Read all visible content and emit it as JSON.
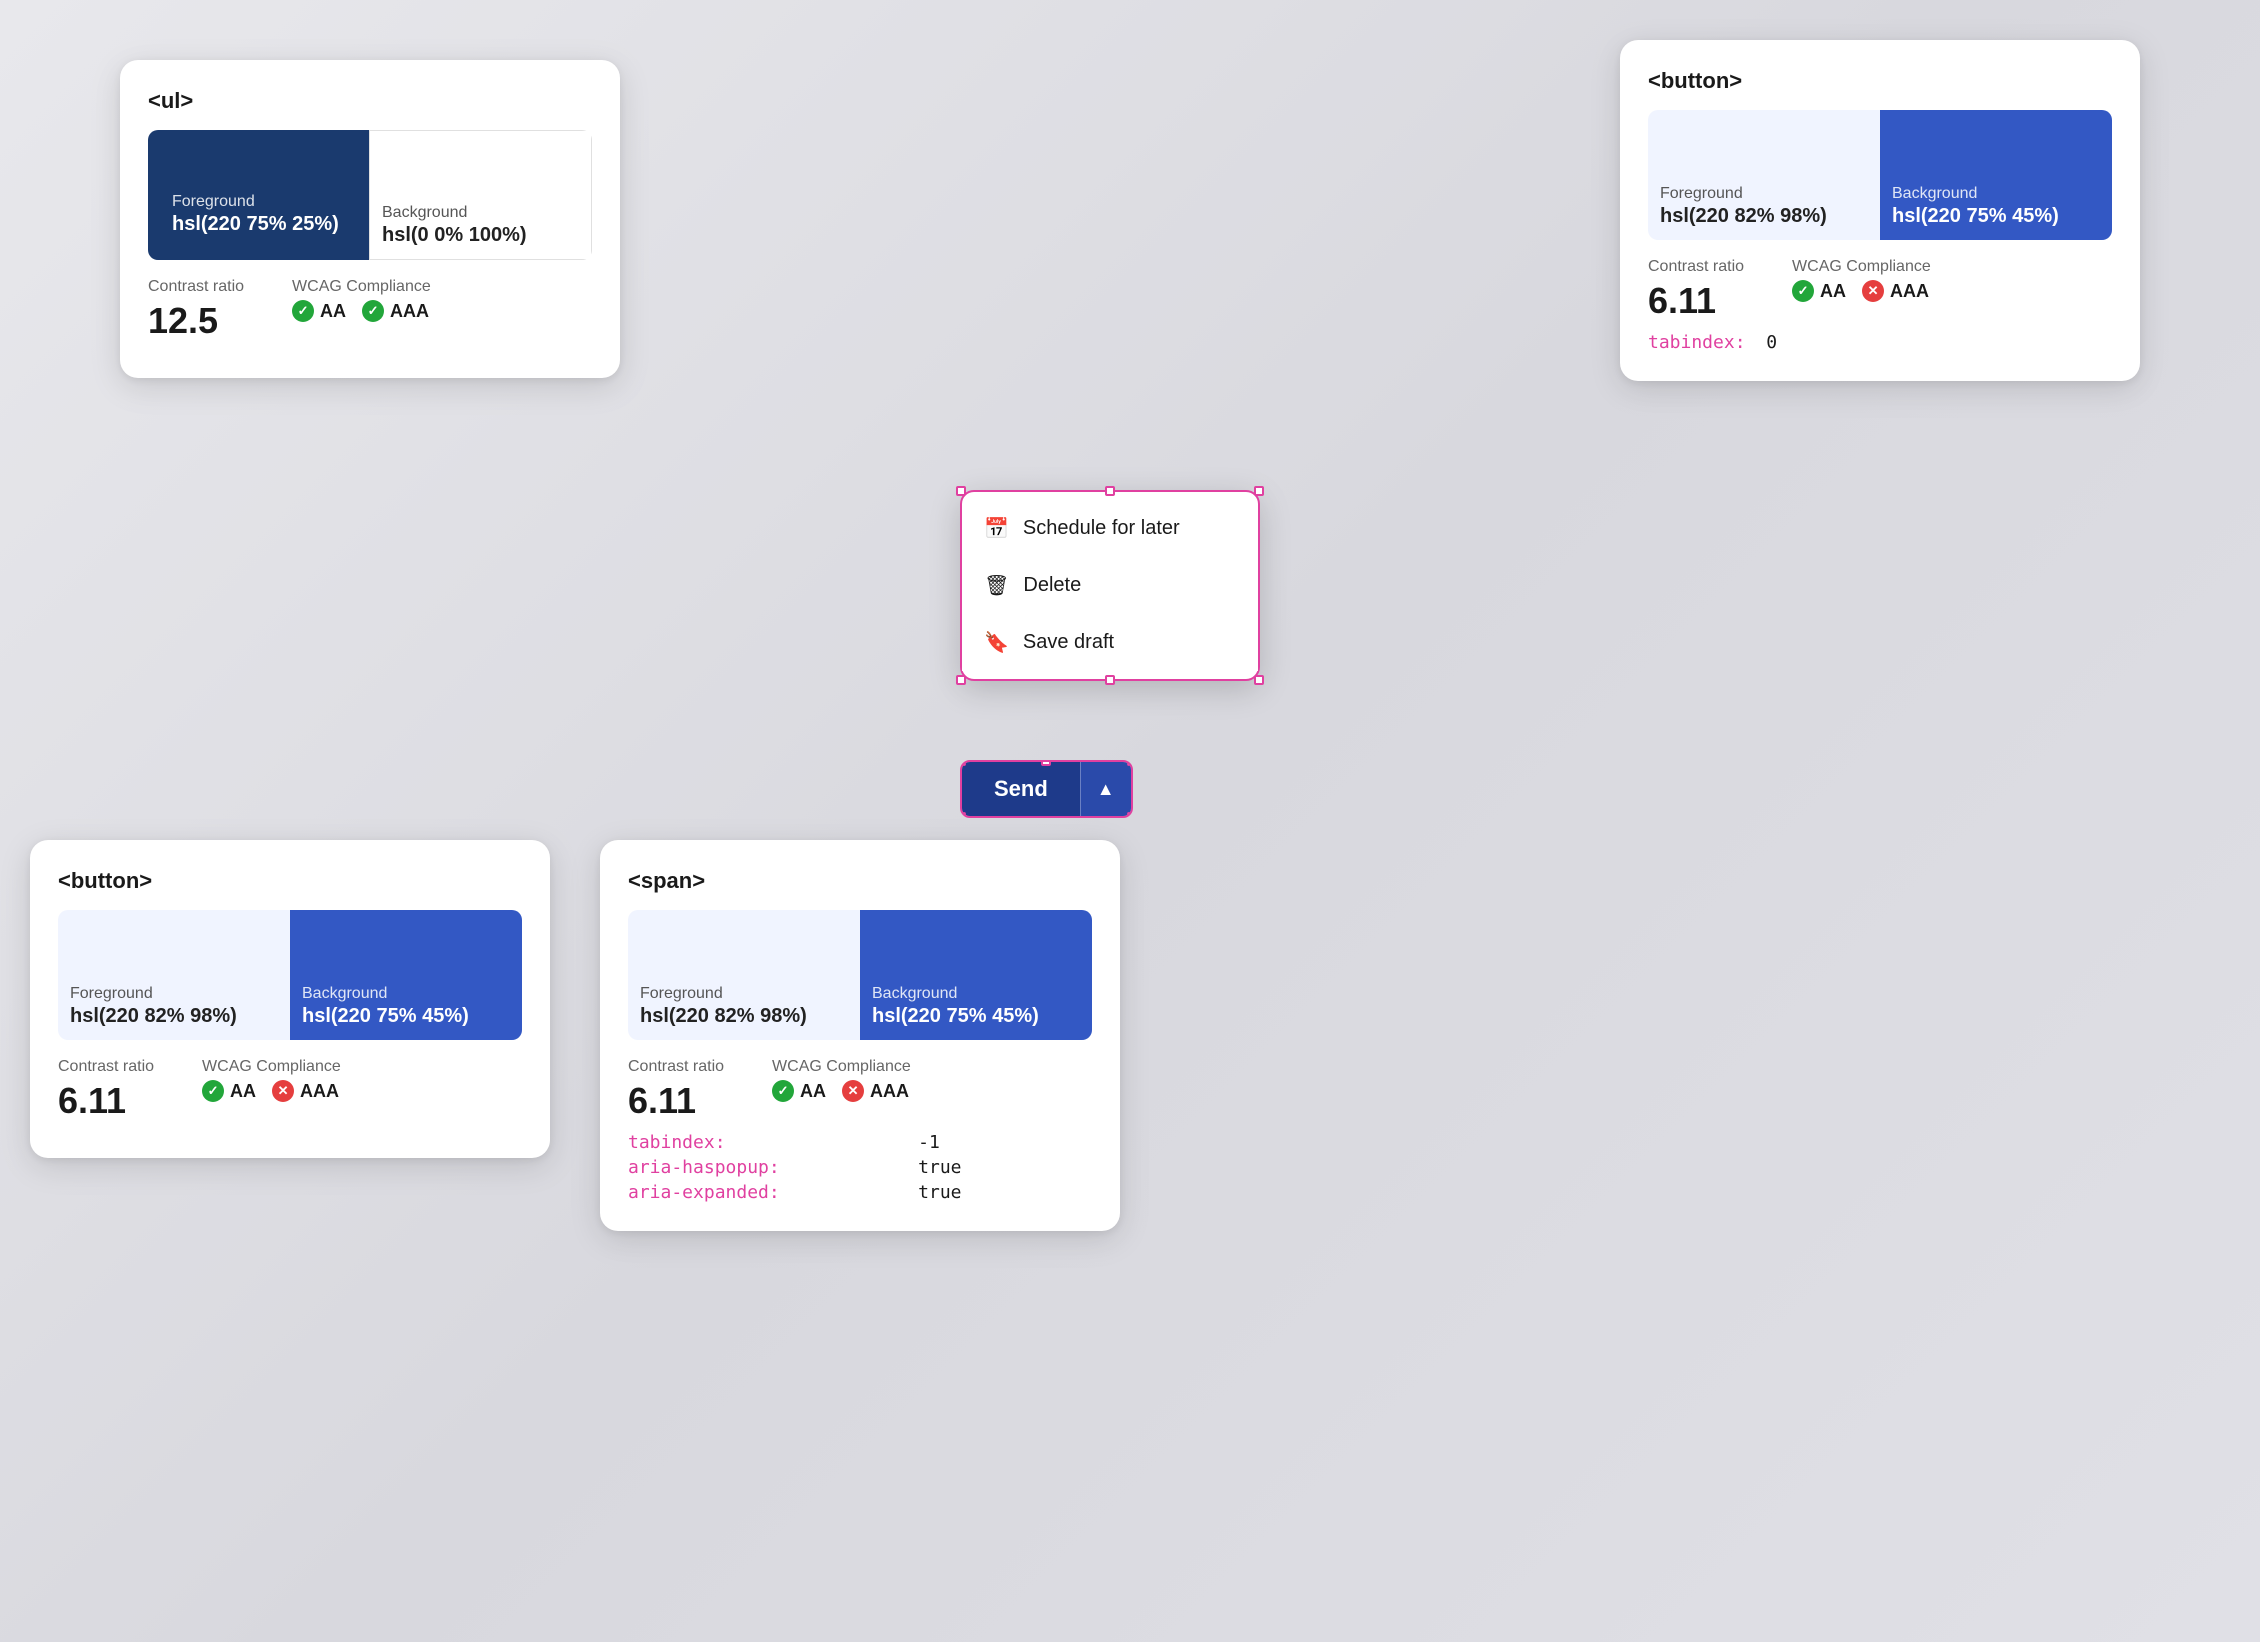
{
  "cards": {
    "top_left": {
      "tag": "<ul>",
      "fg_label": "Foreground",
      "fg_value": "hsl(220 75% 25%)",
      "bg_label": "Background",
      "bg_value": "hsl(0 0% 100%)",
      "contrast_label": "Contrast ratio",
      "contrast_value": "12.5",
      "wcag_label": "WCAG Compliance",
      "aa_label": "AA",
      "aaa_label": "AAA",
      "aa_pass": true,
      "aaa_pass": true
    },
    "top_right": {
      "tag": "<button>",
      "fg_label": "Foreground",
      "fg_value": "hsl(220 82% 98%)",
      "bg_label": "Background",
      "bg_value": "hsl(220 75% 45%)",
      "contrast_label": "Contrast ratio",
      "contrast_value": "6.11",
      "wcag_label": "WCAG Compliance",
      "aa_label": "AA",
      "aaa_label": "AAA",
      "aa_pass": true,
      "aaa_pass": false,
      "tabindex_label": "tabindex:",
      "tabindex_value": "0"
    },
    "bottom_left": {
      "tag": "<button>",
      "fg_label": "Foreground",
      "fg_value": "hsl(220 82% 98%)",
      "bg_label": "Background",
      "bg_value": "hsl(220 75% 45%)",
      "contrast_label": "Contrast ratio",
      "contrast_value": "6.11",
      "wcag_label": "WCAG Compliance",
      "aa_label": "AA",
      "aaa_label": "AAA",
      "aa_pass": true,
      "aaa_pass": false
    },
    "bottom_right": {
      "tag": "<span>",
      "fg_label": "Foreground",
      "fg_value": "hsl(220 82% 98%)",
      "bg_label": "Background",
      "bg_value": "hsl(220 75% 45%)",
      "contrast_label": "Contrast ratio",
      "contrast_value": "6.11",
      "wcag_label": "WCAG Compliance",
      "aa_label": "AA",
      "aaa_label": "AAA",
      "aa_pass": true,
      "aaa_pass": false,
      "tabindex_label": "tabindex:",
      "tabindex_value": "-1",
      "aria_haspopup_label": "aria-haspopup:",
      "aria_haspopup_value": "true",
      "aria_expanded_label": "aria-expanded:",
      "aria_expanded_value": "true"
    }
  },
  "dropdown": {
    "schedule_label": "Schedule for later",
    "delete_label": "Delete",
    "save_draft_label": "Save draft"
  },
  "send_button": {
    "send_label": "Send",
    "chevron": "▲"
  }
}
